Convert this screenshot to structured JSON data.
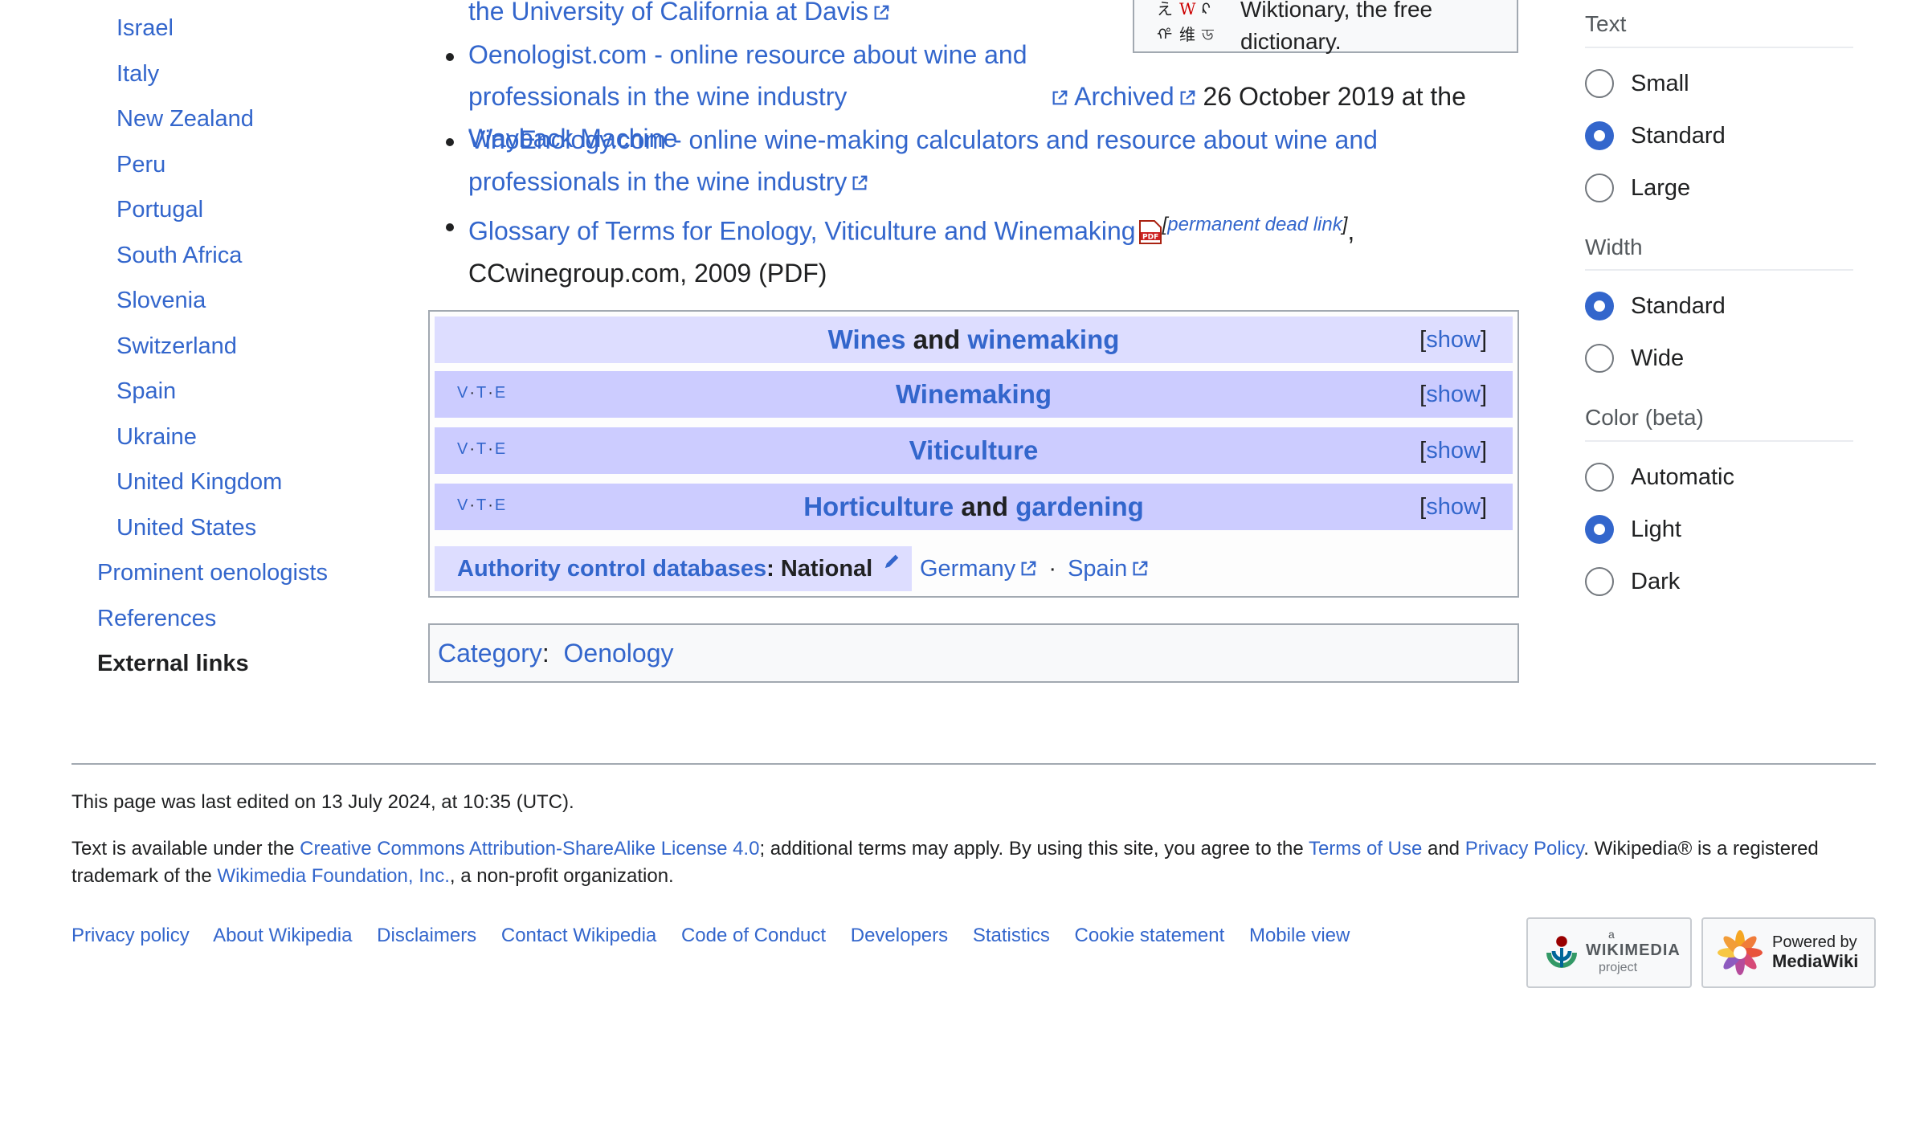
{
  "toc": {
    "items": [
      {
        "label": "Israel",
        "level": 2
      },
      {
        "label": "Italy",
        "level": 2
      },
      {
        "label": "New Zealand",
        "level": 2
      },
      {
        "label": "Peru",
        "level": 2
      },
      {
        "label": "Portugal",
        "level": 2
      },
      {
        "label": "South Africa",
        "level": 2
      },
      {
        "label": "Slovenia",
        "level": 2
      },
      {
        "label": "Switzerland",
        "level": 2
      },
      {
        "label": "Spain",
        "level": 2
      },
      {
        "label": "Ukraine",
        "level": 2
      },
      {
        "label": "United Kingdom",
        "level": 2
      },
      {
        "label": "United States",
        "level": 2
      },
      {
        "label": "Prominent oenologists",
        "level": 1
      },
      {
        "label": "References",
        "level": 1
      },
      {
        "label": "External links",
        "level": 1,
        "active": true
      }
    ]
  },
  "external_links": {
    "item0_tail": "the University of California at Davis",
    "item1": {
      "link": "Oenologist.com - online resource about wine and professionals in the wine industry",
      "archived": "Archived",
      "archived_date": "26 October 2019 at the",
      "wayback": "Wayback Machine"
    },
    "item2": {
      "link": "VinoEnology.com - online wine-making calculators and resource about wine and professionals in the wine industry"
    },
    "item3": {
      "link": "Glossary of Terms for Enology, Viticulture and Winemaking",
      "pdf_icon": "pdf-icon",
      "dead_link": "permanent dead link",
      "tail": "CCwinegroup.com, 2009 (PDF)"
    }
  },
  "wiktionary_box": {
    "text": "Wiktionary, the free dictionary."
  },
  "navboxes": {
    "main": {
      "part1": "Wines",
      "and": "and",
      "part2": "winemaking",
      "show": "show"
    },
    "vte": {
      "v": "V",
      "t": "T",
      "e": "E"
    },
    "rows": [
      {
        "title": "Winemaking",
        "show": "show"
      },
      {
        "title": "Viticulture",
        "show": "show"
      },
      {
        "part1": "Horticulture",
        "and": "and",
        "part2": "gardening",
        "show": "show"
      }
    ],
    "authority": {
      "label_link": "Authority control databases",
      "label_suffix": ": National",
      "edit_icon": "pencil-icon",
      "items": [
        "Germany",
        "Spain"
      ],
      "separator": "·"
    }
  },
  "categories": {
    "label": "Category",
    "items": [
      "Oenology"
    ]
  },
  "appearance": {
    "text": {
      "heading": "Text",
      "options": [
        {
          "label": "Small",
          "checked": false
        },
        {
          "label": "Standard",
          "checked": true
        },
        {
          "label": "Large",
          "checked": false
        }
      ]
    },
    "width": {
      "heading": "Width",
      "options": [
        {
          "label": "Standard",
          "checked": true
        },
        {
          "label": "Wide",
          "checked": false
        }
      ]
    },
    "color": {
      "heading": "Color (beta)",
      "options": [
        {
          "label": "Automatic",
          "checked": false
        },
        {
          "label": "Light",
          "checked": true
        },
        {
          "label": "Dark",
          "checked": false
        }
      ]
    }
  },
  "footer": {
    "last_edited": "This page was last edited on 13 July 2024, at 10:35 (UTC).",
    "license_pre": "Text is available under the ",
    "license_link": "Creative Commons Attribution-ShareAlike License 4.0",
    "license_mid": "; additional terms may apply. By using this site, you agree to the ",
    "terms_link": "Terms of Use",
    "and": " and ",
    "privacy_link": "Privacy Policy",
    "trademark_pre": ". Wikipedia® is a registered trademark of the ",
    "foundation_link": "Wikimedia Foundation, Inc.",
    "trademark_post": ", a non-profit organization.",
    "links": [
      "Privacy policy",
      "About Wikipedia",
      "Disclaimers",
      "Contact Wikipedia",
      "Code of Conduct",
      "Developers",
      "Statistics",
      "Cookie statement",
      "Mobile view"
    ],
    "wikimedia_badge": {
      "small": "a",
      "big": "WIKIMEDIA",
      "sub": "project"
    },
    "mediawiki_badge": {
      "line1": "Powered by",
      "line2": "MediaWiki"
    }
  },
  "colors": {
    "link": "#3366cc",
    "navbox_title_bg": "#ccccff",
    "navbox_group_bg": "#ddddff",
    "radio_checked": "#3366cc"
  }
}
